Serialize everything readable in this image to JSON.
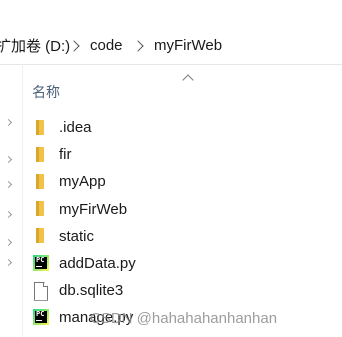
{
  "breadcrumb": {
    "items": [
      "扩加卷 (D:)",
      "code",
      "myFirWeb"
    ]
  },
  "columns": {
    "name_header": "名称"
  },
  "files": [
    {
      "name": ".idea",
      "type": "folder",
      "icon": "folder-icon"
    },
    {
      "name": "fir",
      "type": "folder",
      "icon": "folder-icon"
    },
    {
      "name": "myApp",
      "type": "folder",
      "icon": "folder-icon"
    },
    {
      "name": "myFirWeb",
      "type": "folder",
      "icon": "folder-icon"
    },
    {
      "name": "static",
      "type": "folder",
      "icon": "folder-icon"
    },
    {
      "name": "addData.py",
      "type": "python",
      "icon": "pycharm-file-icon"
    },
    {
      "name": "db.sqlite3",
      "type": "file",
      "icon": "document-icon"
    },
    {
      "name": "manage.py",
      "type": "python",
      "icon": "pycharm-file-icon"
    }
  ],
  "watermark": {
    "text": "CSDN @hahahahanhanhan"
  },
  "colors": {
    "folder": "#f0c24a",
    "header_text": "#4c607a"
  }
}
